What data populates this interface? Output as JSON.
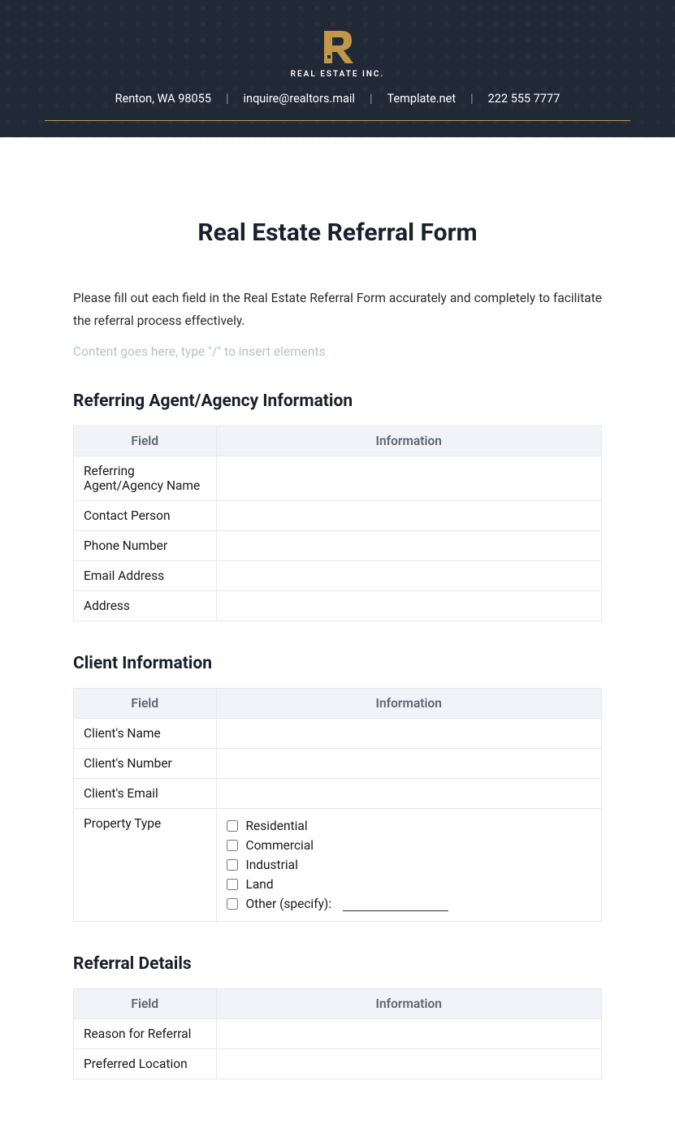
{
  "header": {
    "company_name": "REAL ESTATE INC.",
    "location": "Renton, WA 98055",
    "email": "inquire@realtors.mail",
    "website": "Template.net",
    "phone": "222 555 7777"
  },
  "title": "Real Estate Referral Form",
  "intro": "Please fill out each field in the Real Estate Referral Form accurately and completely to facilitate the referral process effectively.",
  "placeholder": "Content goes here, type \"/\" to insert elements",
  "table_headers": {
    "field": "Field",
    "info": "Information"
  },
  "sections": {
    "agent": {
      "heading": "Referring Agent/Agency Information",
      "rows": [
        {
          "label": "Referring Agent/Agency Name",
          "value": ""
        },
        {
          "label": "Contact Person",
          "value": ""
        },
        {
          "label": "Phone Number",
          "value": ""
        },
        {
          "label": "Email Address",
          "value": ""
        },
        {
          "label": "Address",
          "value": ""
        }
      ]
    },
    "client": {
      "heading": "Client Information",
      "rows": [
        {
          "label": "Client's Name",
          "value": ""
        },
        {
          "label": "Client's Number",
          "value": ""
        },
        {
          "label": "Client's Email",
          "value": ""
        }
      ],
      "property_label": "Property Type",
      "property_types": [
        "Residential",
        "Commercial",
        "Industrial",
        "Land"
      ],
      "other_label": "Other (specify):"
    },
    "referral": {
      "heading": "Referral Details",
      "rows": [
        {
          "label": "Reason for Referral",
          "value": ""
        },
        {
          "label": "Preferred Location",
          "value": ""
        }
      ]
    }
  }
}
